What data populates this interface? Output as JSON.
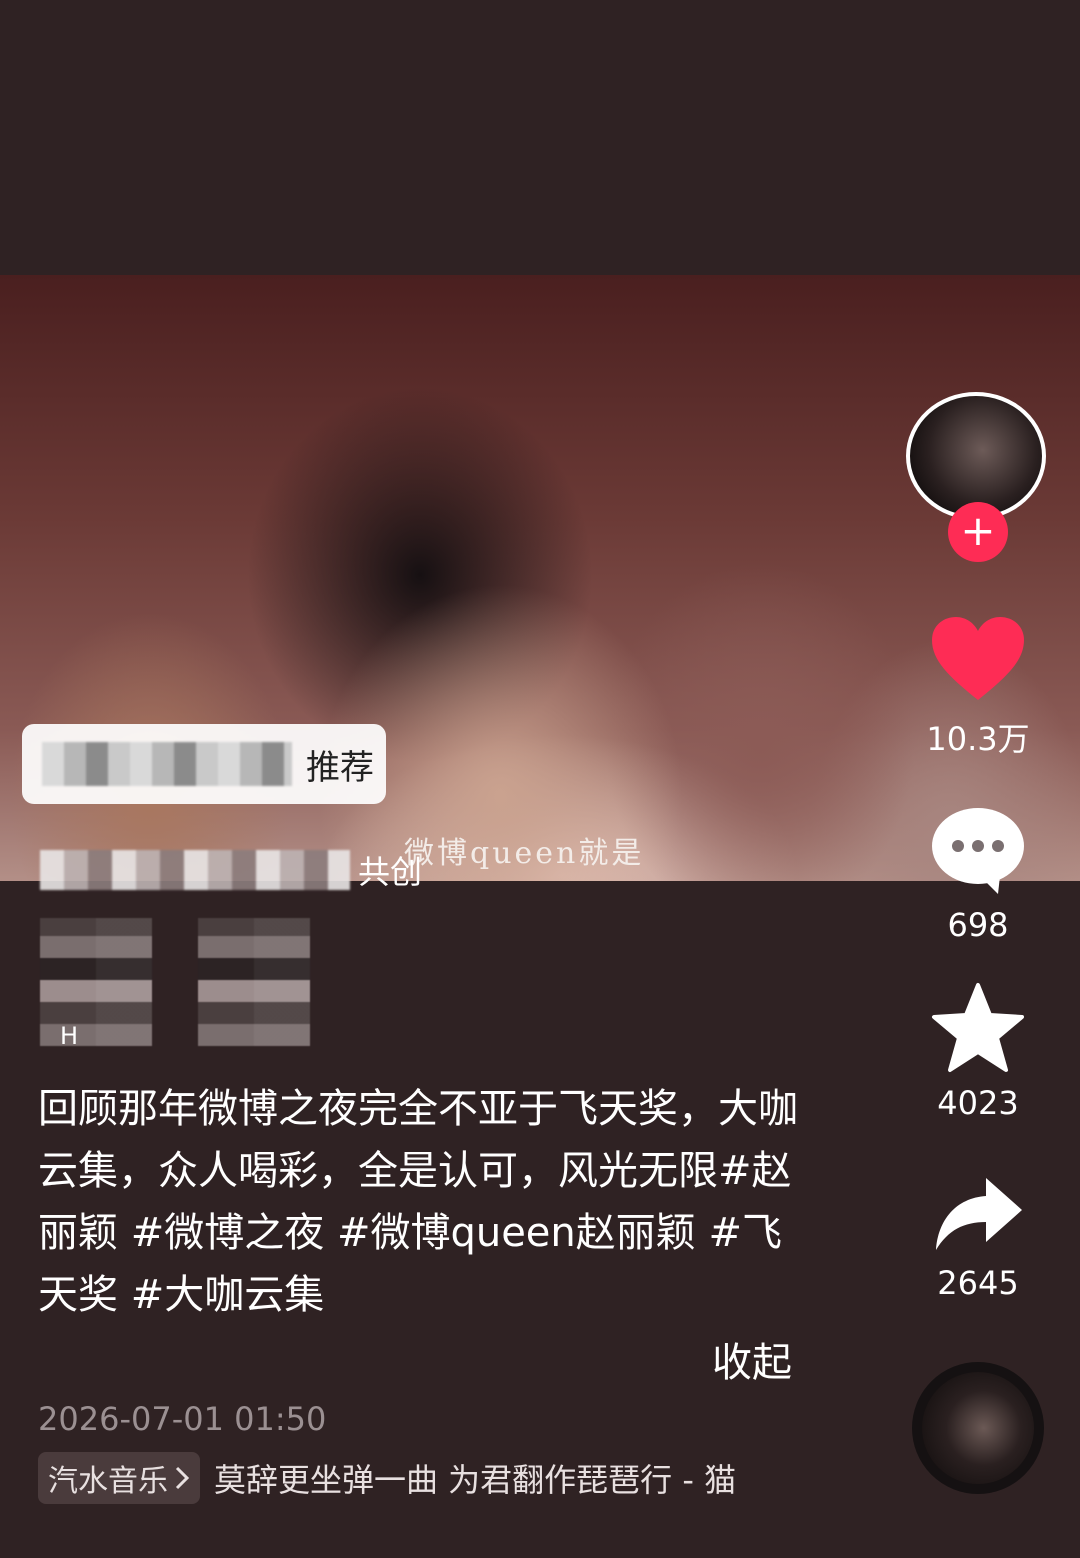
{
  "video": {
    "subtitle": "微博queen就是",
    "recommend_tag": "推荐",
    "cocreate_label": "共创"
  },
  "creators": [
    {
      "name": "H"
    },
    {
      "name": ""
    }
  ],
  "rail": {
    "like_count": "10.3万",
    "comment_count": "698",
    "favorite_count": "4023",
    "share_count": "2645",
    "follow_symbol": "+"
  },
  "post": {
    "description": "回顾那年微博之夜完全不亚于飞天奖，大咖云集，众人喝彩，全是认可，风光无限#赵丽颖 #微博之夜 #微博queen赵丽颖 #飞天奖 #大咖云集",
    "collapse_label": "收起",
    "timestamp": "2026-07-01 01:50"
  },
  "music": {
    "app_tag": "汽水音乐",
    "title": "莫辞更坐弹一曲 为君翻作琵琶行 - 猫"
  },
  "colors": {
    "background": "#2f2223",
    "like": "#fe2c55",
    "follow": "#fe2c55"
  },
  "icons": [
    "follow-plus-icon",
    "heart-icon",
    "comment-icon",
    "star-icon",
    "share-icon",
    "chevron-right-icon",
    "music-disc-icon"
  ]
}
